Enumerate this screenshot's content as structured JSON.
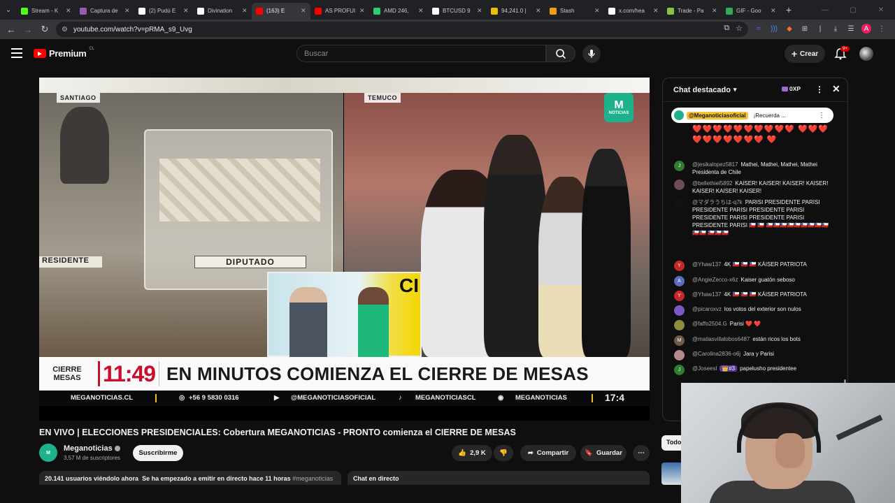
{
  "browser": {
    "tabs": [
      {
        "title": "Stream - K",
        "color": "#53fc18"
      },
      {
        "title": "Captura de",
        "color": "#9b59b6"
      },
      {
        "title": "(2) Pudú E",
        "color": "#ffffff"
      },
      {
        "title": "Divination",
        "color": "#ffffff"
      },
      {
        "title": "(163) E",
        "color": "#ff0000"
      },
      {
        "title": "AS PROFUI",
        "color": "#ff0000"
      },
      {
        "title": "AMD 246,",
        "color": "#2ecc71"
      },
      {
        "title": "BTCUSD 9",
        "color": "#ffffff"
      },
      {
        "title": "94,241.0 |",
        "color": "#f0b90b"
      },
      {
        "title": "Stash",
        "color": "#f39c12"
      },
      {
        "title": "x.com/hea",
        "color": "#ffffff"
      },
      {
        "title": "Trade - Pa",
        "color": "#8bc34a"
      },
      {
        "title": "GIF - Goo",
        "color": "#34a853"
      }
    ],
    "url": "youtube.com/watch?v=pRMA_s9_Uvg"
  },
  "header": {
    "logo_text": "Premium",
    "logo_region": "CL",
    "search_placeholder": "Buscar",
    "create_label": "Crear",
    "notif_badge": "9+"
  },
  "player": {
    "loc_left": "SANTIAGO",
    "loc_right": "TEMUCO",
    "logo_text": "NOTICIAS",
    "label_diputado": "DIPUTADO",
    "label_presidente": "RESIDENTE",
    "banner_left": "CIERRE MESAS",
    "banner_time": "11:49",
    "banner_headline": "EN MINUTOS COMIENZA EL CIERRE DE MESAS",
    "ticker": {
      "site": "MEGANOTICIAS.CL",
      "phone": "+56 9 5830 0316",
      "youtube": "@MEGANOTICIASOFICIAL",
      "tiktok": "MEGANOTICIASCL",
      "other": "MEGANOTICIAS",
      "clock": "17:4"
    }
  },
  "video": {
    "title": "EN VIVO | ELECCIONES PRESIDENCIALES: Cobertura MEGANOTICIAS - PRONTO comienza el CIERRE DE MESAS",
    "channel": "Meganoticias",
    "subscribers": "3,57 M de suscriptores",
    "subscribe_label": "Suscribirme",
    "likes": "2,9 K",
    "share_label": "Compartir",
    "save_label": "Guardar",
    "viewers": "20.141 usuarios viéndolo ahora",
    "started": "Se ha empezado a emitir en directo hace 11 horas",
    "hashtag": "#meganoticias",
    "chat_live_label": "Chat en directo"
  },
  "chat": {
    "header": "Chat destacado",
    "xp": "0XP",
    "pinned_user": "@Meganoticiasoficial",
    "pinned_text": "¡Recuerda ...",
    "messages": [
      {
        "user": "@jesikalopez5817",
        "text": "Mathei, Mathei, Mathei, Mathei Presidenta de Chile",
        "initial": "J",
        "color": "#2e7d32"
      },
      {
        "user": "@bellethiel5892",
        "text": "KAISER! KAISER! KAISER! KAISER! KAISER! KAISER! KAISER!",
        "initial": "",
        "color": "#6d4c5a"
      },
      {
        "user": "@マダラうちは-q7k",
        "text": "PARISI PRESIDENTE PARISI PRESIDENTE PARISI PRESIDENTE PARISI PRESIDENTE PARISI PRESIDENTE PARISI PRESIDENTE PARISI 🇨🇱 🇨🇱 🇨🇱🇨🇱🇨🇱🇨🇱🇨🇱🇨🇱🇨🇱🇨🇱🇨🇱🇨🇱🇨🇱 🇨🇱🇨🇱🇨🇱",
        "initial": "",
        "color": "#111111"
      },
      {
        "user": "@Yhaw137",
        "text": "4K 🇨🇱 🇨🇱 🇨🇱 KÁISER PATRIOTA",
        "initial": "Y",
        "color": "#c62828"
      },
      {
        "user": "@AngieZecco-x6z",
        "text": "Kaiser guatón seboso",
        "initial": "A",
        "color": "#5c6bc0"
      },
      {
        "user": "@Yhaw137",
        "text": "4K 🇨🇱 🇨🇱 🇨🇱 KÁISER PATRIOTA",
        "initial": "Y",
        "color": "#c62828"
      },
      {
        "user": "@picaroxvz",
        "text": "los votos del exterior son nulos",
        "initial": "",
        "color": "#7e57c2"
      },
      {
        "user": "@faffo2504.G",
        "text": "Parisi ❤️ ❤️",
        "initial": "",
        "color": "#8d8d3a"
      },
      {
        "user": "@matiasvillalobos6487",
        "text": "están ricos los bots",
        "initial": "M",
        "color": "#6d5a4a"
      },
      {
        "user": "@Carolina2836-o6j",
        "text": "Jara y Parisi",
        "initial": "",
        "color": "#b38b8b"
      },
      {
        "user": "@Joseesl",
        "text": "papelusho presidentee",
        "initial": "J",
        "color": "#2e7d32",
        "badge": "👑#3"
      }
    ]
  },
  "sidebar": {
    "filter_label": "Todo"
  }
}
